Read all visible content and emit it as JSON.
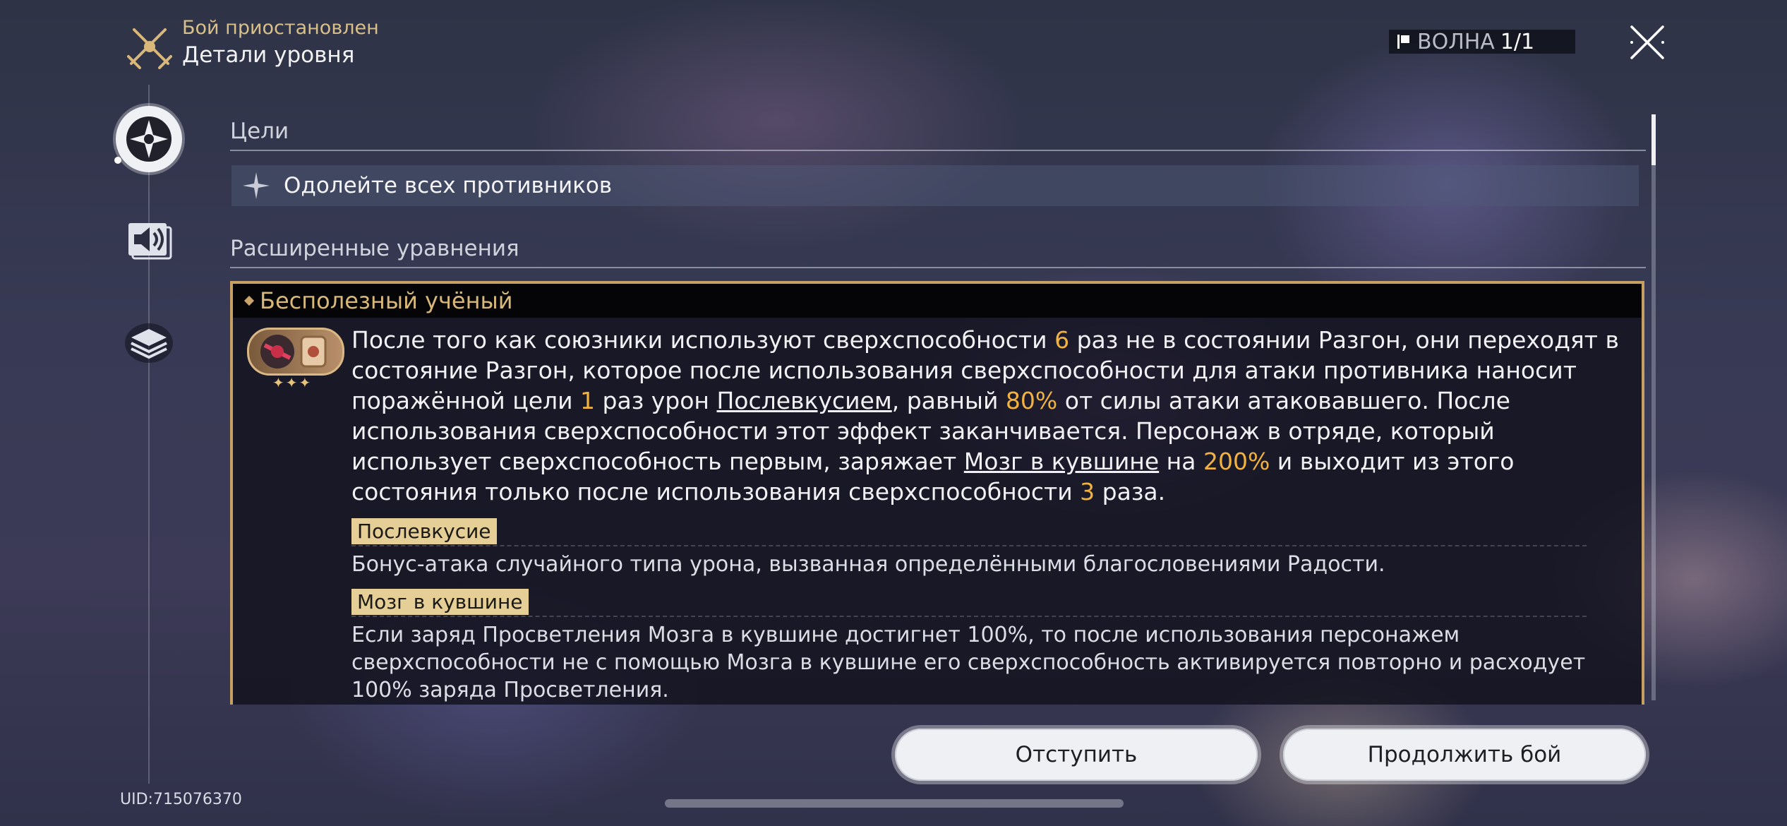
{
  "header": {
    "status": "Бой приостановлен",
    "title": "Детали уровня",
    "icon": "crossed-swords-icon",
    "wave_label": "ВОЛНА",
    "wave_value": "1/1"
  },
  "nav": {
    "items": [
      {
        "icon": "compass-star-icon",
        "active": true
      },
      {
        "icon": "speaker-icon",
        "active": false
      },
      {
        "icon": "layers-icon",
        "active": false
      }
    ]
  },
  "goals": {
    "title": "Цели",
    "item": "Одолейте всех противников"
  },
  "equations": {
    "title": "Расширенные уравнения",
    "card": {
      "name": "Бесполезный учёный",
      "stars": "✦✦✦",
      "description": {
        "p1": "После того как союзники используют сверхспособности ",
        "n1": "6",
        "p2": " раз не в состоянии Разгон, они переходят в состояние Разгон, которое после использования сверхспособности для атаки противника наносит поражённой цели ",
        "n2": "1",
        "p3": " раз урон ",
        "link1": "Послевкусием",
        "p4": ", равный ",
        "n3": "80%",
        "p5": " от силы атаки атаковавшего. После использования сверхспособности этот эффект заканчивается. Персонаж в отряде, который использует сверхспособность первым, заряжает ",
        "link2": "Мозг в кувшине",
        "p6": " на ",
        "n4": "200%",
        "p7": " и выходит из этого состояния только после использования сверхспособности ",
        "n5": "3",
        "p8": " раза."
      },
      "terms": [
        {
          "term": "Послевкусие",
          "text": "Бонус-атака случайного типа урона, вызванная определёнными благословениями Радости."
        },
        {
          "term": "Мозг в кувшине",
          "text": "Если заряд Просветления Мозга в кувшине достигнет 100%, то после использования персонажем сверхспособности не с помощью Мозга в кувшине его сверхспособность активируется повторно и расходует 100% заряда Просветления."
        }
      ]
    }
  },
  "buttons": {
    "retreat": "Отступить",
    "continue": "Продолжить бой"
  },
  "uid": "UID:715076370",
  "colors": {
    "accent_gold": "#c6a063",
    "highlight": "#f2b23f",
    "tag_bg": "#e6cf96"
  }
}
